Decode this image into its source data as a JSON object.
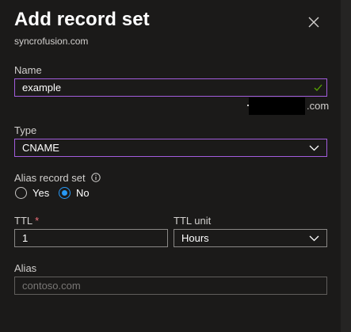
{
  "header": {
    "title": "Add record set",
    "subtitle": "syncrofusion.com"
  },
  "form": {
    "name": {
      "label": "Name",
      "value": "example",
      "valid_icon": "checkmark-icon",
      "domain_suffix": ".com"
    },
    "type": {
      "label": "Type",
      "selected": "CNAME"
    },
    "alias_record_set": {
      "label": "Alias record set",
      "info_icon": "info-icon",
      "options": [
        "Yes",
        "No"
      ],
      "selected": "No"
    },
    "ttl": {
      "label": "TTL",
      "required_mark": "*",
      "value": "1"
    },
    "ttl_unit": {
      "label": "TTL unit",
      "selected": "Hours"
    },
    "alias": {
      "label": "Alias",
      "placeholder": "contoso.com"
    }
  },
  "colors": {
    "focus_border": "#a25ddc",
    "radio_accent": "#2899f5",
    "valid_check": "#57a300",
    "required": "#f1707b",
    "background": "#1b1a19"
  }
}
